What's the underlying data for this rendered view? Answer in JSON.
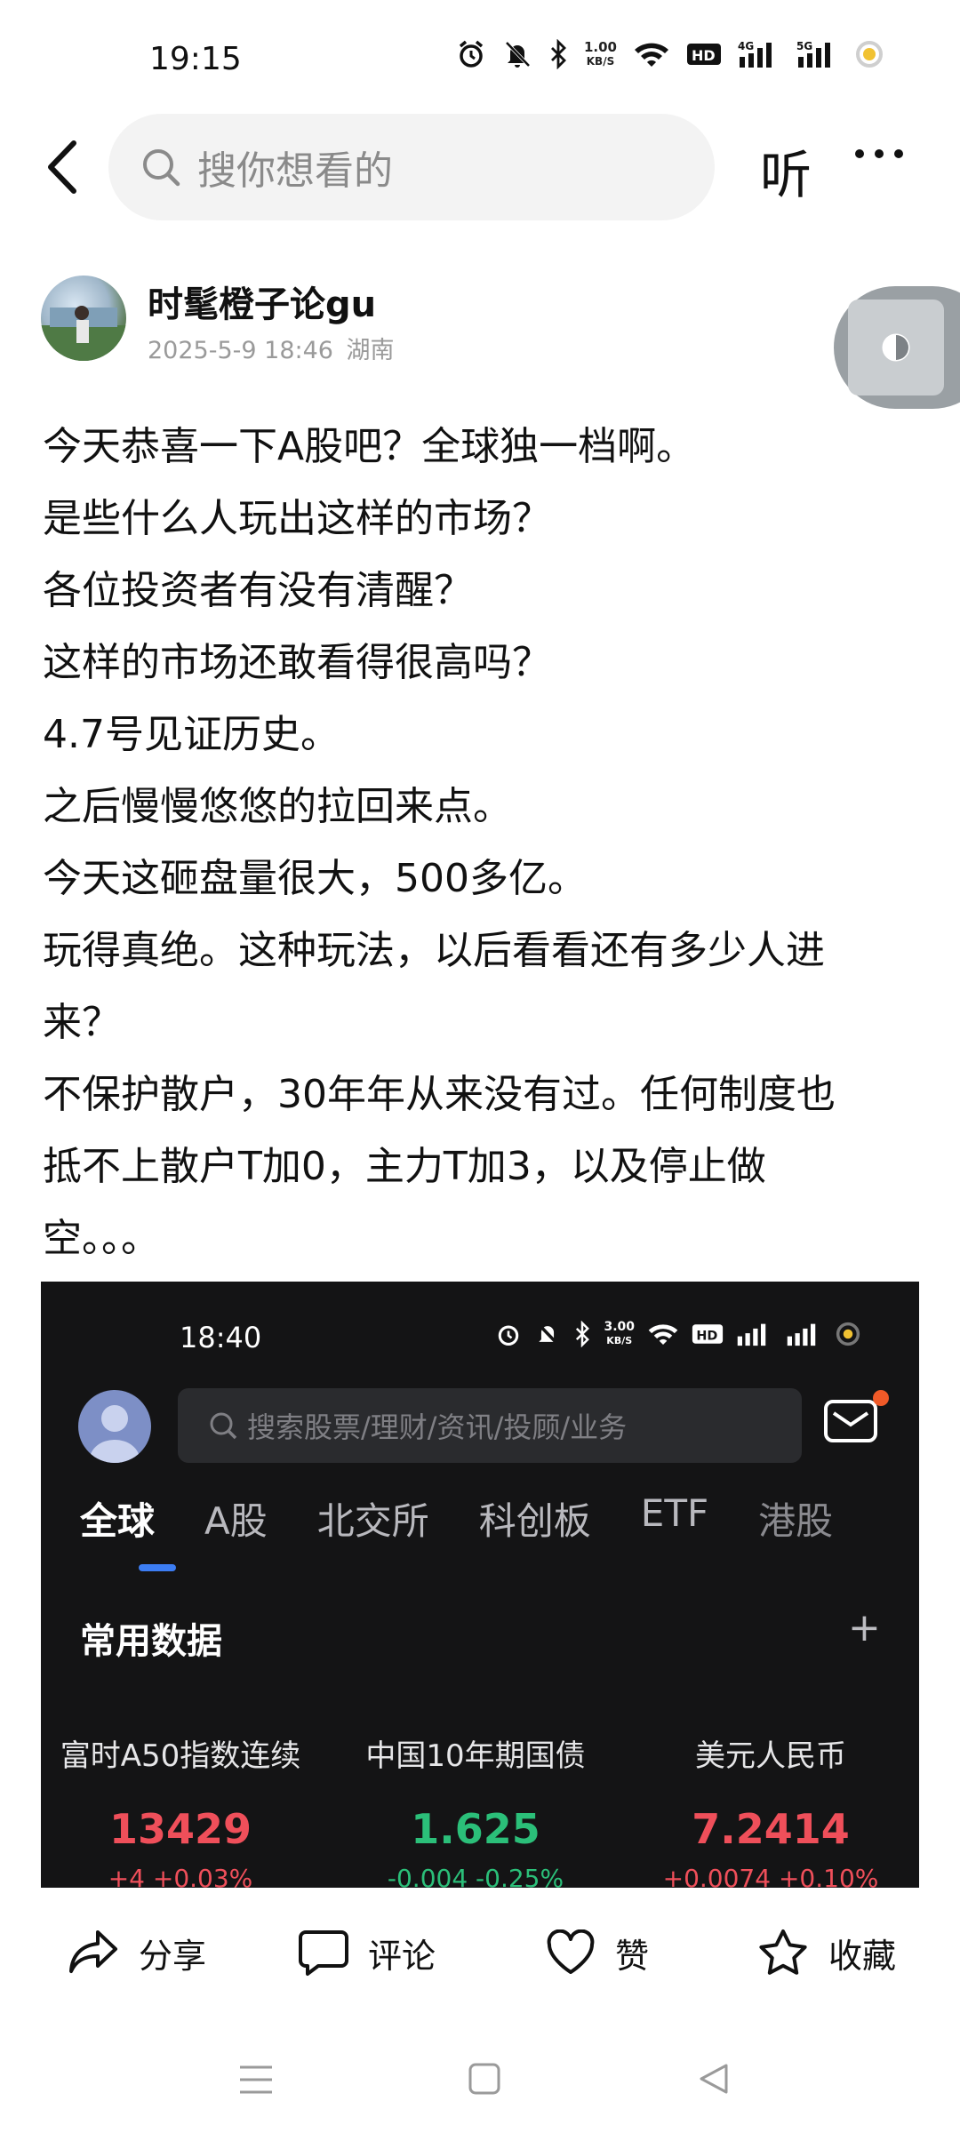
{
  "status_bar": {
    "time": "19:15",
    "net_speed_value": "1.00",
    "net_speed_unit": "KB/S",
    "hd": "HD",
    "sim1": "4G",
    "sim2": "5G"
  },
  "top_bar": {
    "search_placeholder": "搜你想看的",
    "listen_label": "听"
  },
  "post": {
    "author": "时髦橙子论gu",
    "date": "2025-5-9 18:46",
    "location": "湖南",
    "lines": [
      "今天恭喜一下A股吧？全球独一档啊。",
      "是些什么人玩出这样的市场？",
      "各位投资者有没有清醒？",
      "这样的市场还敢看得很高吗？",
      "4.7号见证历史。",
      "之后慢慢悠悠的拉回来点。",
      "今天这砸盘量很大，500多亿。",
      "玩得真绝。这种玩法，以后看看还有多少人进",
      "来？",
      "不保护散户，30年年从来没有过。任何制度也",
      "抵不上散户T加0，主力T加3，以及停止做",
      "空。。。"
    ]
  },
  "embedded_screenshot": {
    "time": "18:40",
    "net_speed_value": "3.00",
    "net_speed_unit": "KB/S",
    "search_placeholder": "搜索股票/理财/资讯/投顾/业务",
    "tabs": [
      "全球",
      "A股",
      "北交所",
      "科创板",
      "ETF",
      "港股"
    ],
    "active_tab": "全球",
    "section_title": "常用数据",
    "plus": "+",
    "cards": [
      {
        "name": "富时A50指数连续",
        "value": "13429",
        "change": "+4  +0.03%",
        "trend": "up"
      },
      {
        "name": "中国10年期国债",
        "value": "1.625",
        "change": "-0.004  -0.25%",
        "trend": "down"
      },
      {
        "name": "美元人民币",
        "value": "7.2414",
        "change": "+0.0074  +0.10%",
        "trend": "up"
      }
    ],
    "colors": {
      "up": "#ef4f5a",
      "down": "#2bbf79",
      "accent": "#3c7df3"
    }
  },
  "actions": {
    "share": "分享",
    "comment": "评论",
    "like": "赞",
    "favorite": "收藏"
  }
}
